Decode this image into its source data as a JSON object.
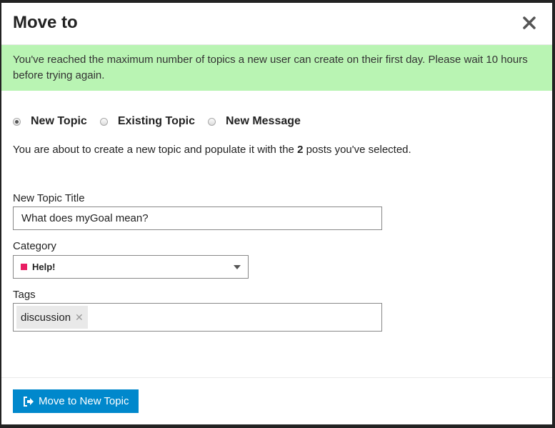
{
  "modal": {
    "title": "Move to",
    "close_icon": "close-icon"
  },
  "alert": {
    "text": "You've reached the maximum number of topics a new user can create on their first day. Please wait 10 hours before trying again.",
    "background": "#b9f4b3"
  },
  "options": [
    {
      "label": "New Topic",
      "checked": true
    },
    {
      "label": "Existing Topic",
      "checked": false
    },
    {
      "label": "New Message",
      "checked": false
    }
  ],
  "description": {
    "before": "You are about to create a new topic and populate it with the ",
    "count": "2",
    "after": " posts you've selected."
  },
  "topic_title": {
    "label": "New Topic Title",
    "value": "What does myGoal mean?"
  },
  "category": {
    "label": "Category",
    "selected": "Help!",
    "color": "#e91e63"
  },
  "tags": {
    "label": "Tags",
    "items": [
      "discussion"
    ]
  },
  "footer": {
    "button_label": "Move to New Topic",
    "button_color": "#0088cc",
    "button_icon": "sign-out-icon"
  }
}
